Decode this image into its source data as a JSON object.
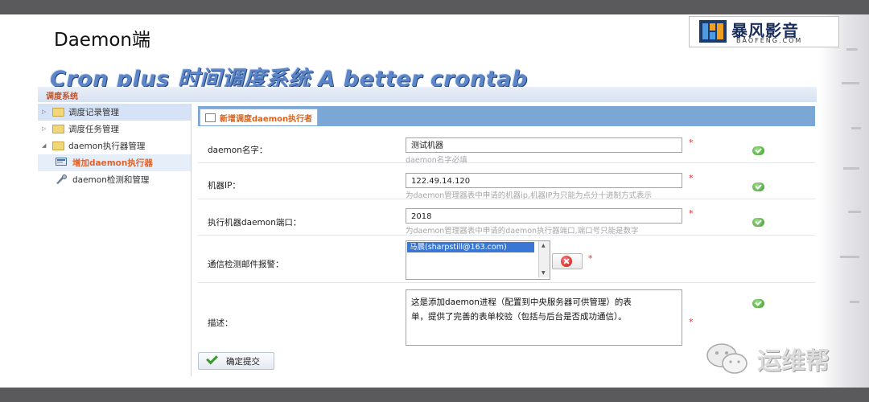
{
  "slide": {
    "title": "Daemon端",
    "banner": "Cron plus 时间调度系统 A better crontab",
    "logo": {
      "cn": "暴风影音",
      "en": "BAOFENG.COM"
    }
  },
  "app": {
    "title": "调度系统",
    "sidebar": {
      "items": [
        {
          "label": "调度记录管理"
        },
        {
          "label": "调度任务管理"
        },
        {
          "label": "daemon执行器管理"
        },
        {
          "label": "增加daemon执行器"
        },
        {
          "label": "daemon检测和管理"
        }
      ]
    },
    "form": {
      "tab_label": "新增调度daemon执行者",
      "name": {
        "label": "daemon名字：",
        "value": "测试机器",
        "hint": "daemon名字必填",
        "required": "*"
      },
      "ip": {
        "label": "机器IP：",
        "value": "122.49.14.120",
        "hint": "为daemon管理器表中申请的机器ip,机器IP为只能为点分十进制方式表示",
        "required": "*"
      },
      "port": {
        "label": "执行机器daemon端口：",
        "value": "2018",
        "hint": "为daemon管理器表中申请的daemon执行器端口,端口号只能是数字",
        "required": "*"
      },
      "email": {
        "label": "通信检测邮件报警：",
        "selected": "马晨(sharpstill@163.com)",
        "required": "*"
      },
      "desc": {
        "label": "描述：",
        "line1": "这是添加daemon进程（配置到中央服务器可供管理）的表",
        "line2": "单，提供了完善的表单校验（包括与后台是否成功通信）。",
        "required": "*"
      },
      "submit_label": "确定提交"
    }
  },
  "watermark": "运维帮",
  "colors": {
    "top_bar": "#5a5a5c",
    "tab_bar": "#7aa7d6",
    "accent_orange": "#e0632b",
    "ok_green": "#3d9a2a",
    "error_red": "#c41414"
  }
}
